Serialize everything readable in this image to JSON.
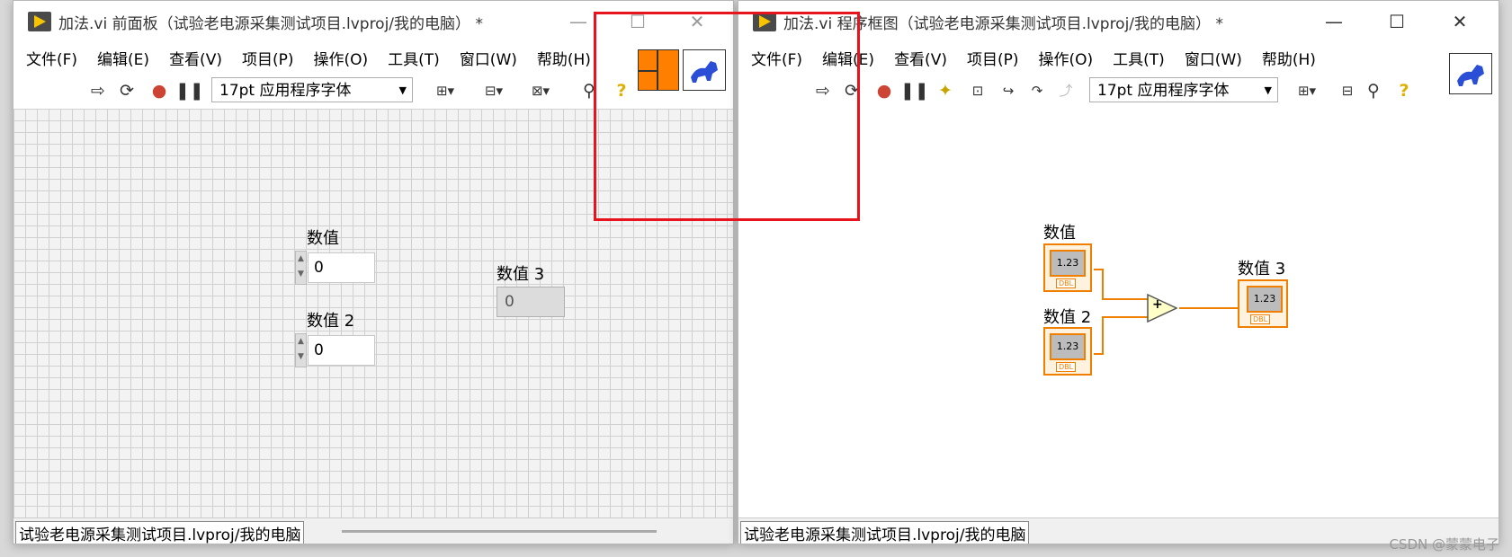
{
  "front_panel": {
    "title": "加法.vi 前面板（试验老电源采集测试项目.lvproj/我的电脑） *",
    "menu": [
      "文件(F)",
      "编辑(E)",
      "查看(V)",
      "项目(P)",
      "操作(O)",
      "工具(T)",
      "窗口(W)",
      "帮助(H)"
    ],
    "font_select": "17pt 应用程序字体",
    "controls": [
      {
        "label": "数值",
        "value": "0"
      },
      {
        "label": "数值 2",
        "value": "0"
      }
    ],
    "indicator": {
      "label": "数值 3",
      "value": "0"
    },
    "status": "试验老电源采集测试项目.lvproj/我的电脑"
  },
  "block_diagram": {
    "title": "加法.vi 程序框图（试验老电源采集测试项目.lvproj/我的电脑） *",
    "menu": [
      "文件(F)",
      "编辑(E)",
      "查看(V)",
      "项目(P)",
      "操作(O)",
      "工具(T)",
      "窗口(W)",
      "帮助(H)"
    ],
    "font_select": "17pt 应用程序字体",
    "nodes": [
      {
        "label": "数值",
        "text": "1.23",
        "type": "DBL"
      },
      {
        "label": "数值 2",
        "text": "1.23",
        "type": "DBL"
      },
      {
        "label": "数值 3",
        "text": "1.23",
        "type": "DBL"
      }
    ],
    "add_symbol": "+",
    "status": "试验老电源采集测试项目.lvproj/我的电脑"
  },
  "window_buttons": {
    "minimize": "—",
    "maximize": "☐",
    "close": "✕"
  },
  "watermark": "CSDN @蒙蒙电子",
  "colors": {
    "wire": "#f07f00",
    "highlight": "#e8141d",
    "connector_orange": "#ff7f00"
  }
}
